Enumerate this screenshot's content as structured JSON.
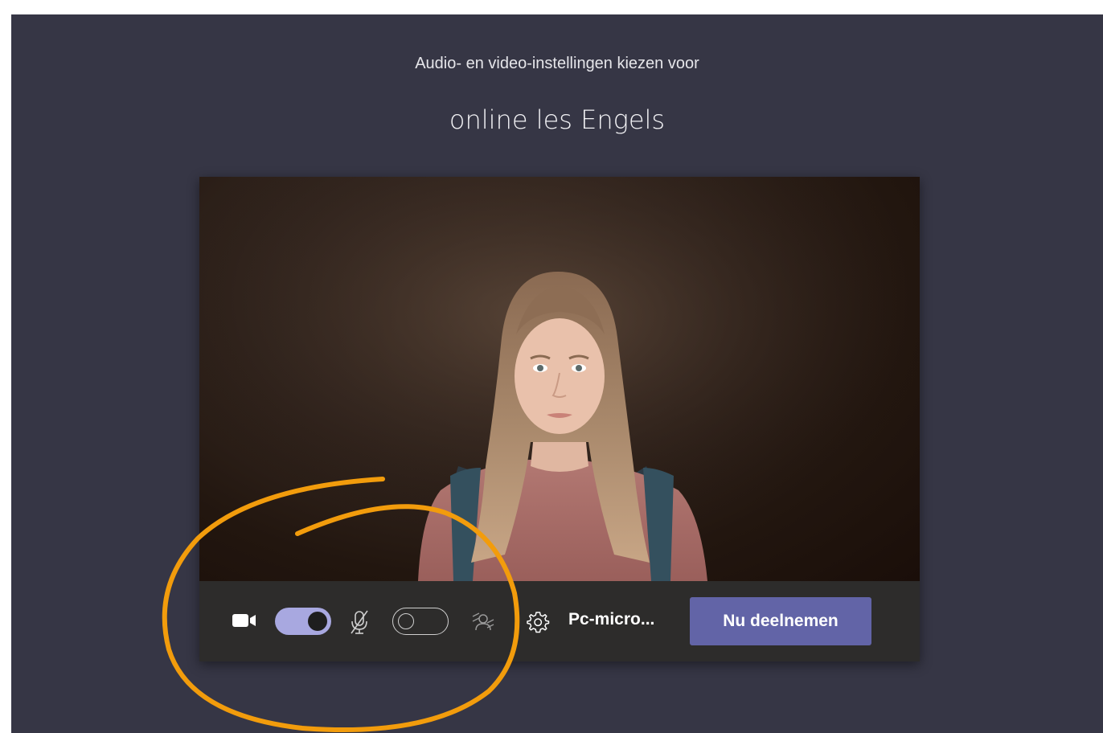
{
  "header": {
    "subtitle": "Audio- en video-instellingen kiezen voor",
    "meeting_title": "online les Engels"
  },
  "controls": {
    "camera_icon": "video-camera-icon",
    "camera_toggle_state": "on",
    "mic_icon": "microphone-off-icon",
    "mic_toggle_state": "off",
    "blur_icon": "background-blur-icon",
    "settings_icon": "gear-icon",
    "audio_device_label": "Pc-micro...",
    "join_button_label": "Nu deelnemen"
  },
  "colors": {
    "background": "#363645",
    "control_bar": "#2d2c2b",
    "join_button": "#6264a7",
    "toggle_on": "#a8a8e0",
    "annotation": "#f29c0c"
  },
  "annotation": {
    "shape": "hand-drawn-circle"
  }
}
